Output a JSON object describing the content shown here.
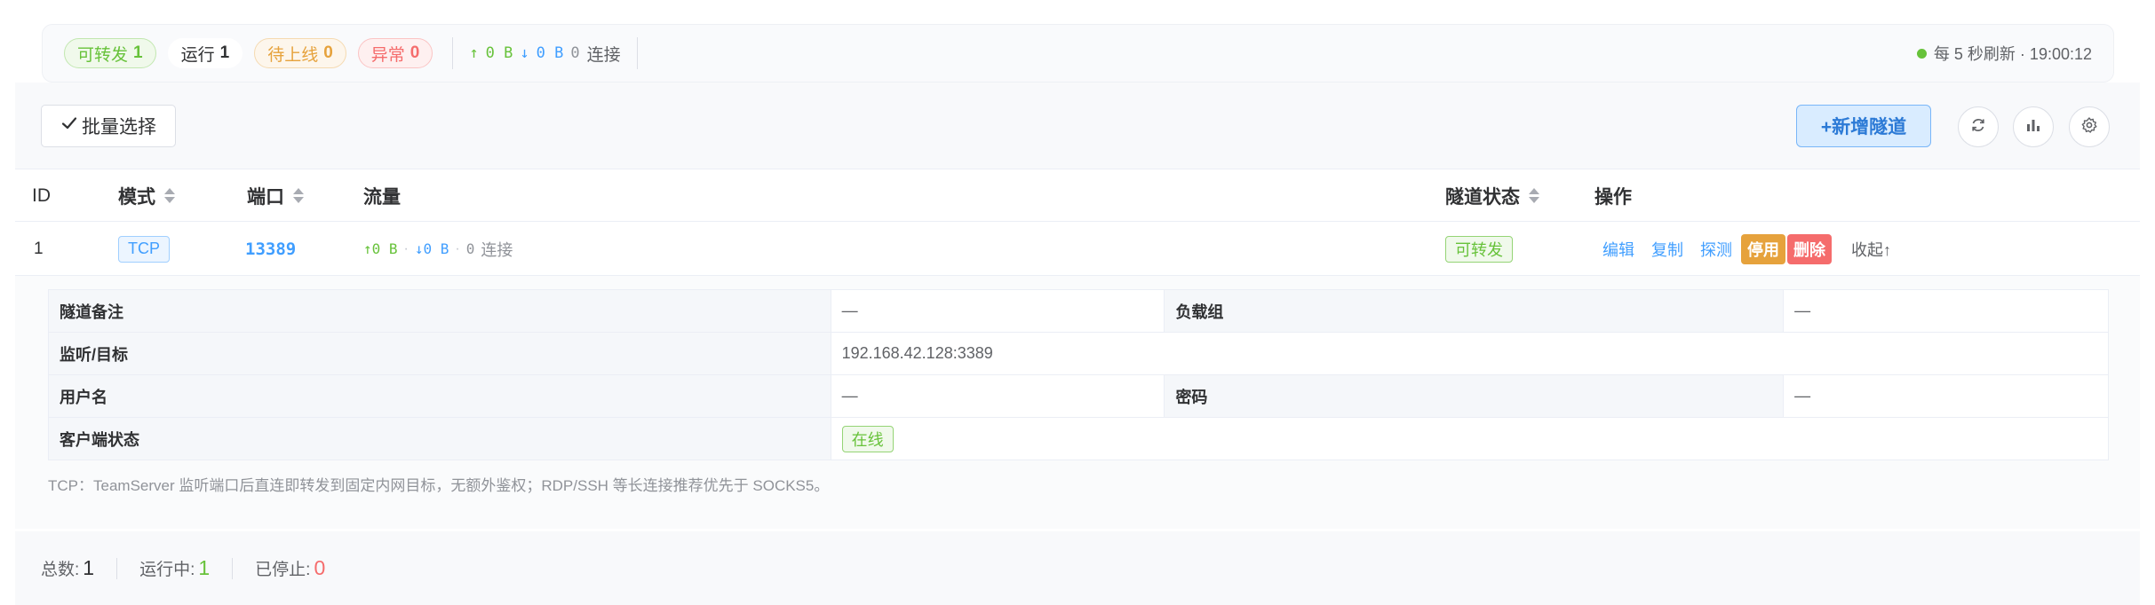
{
  "status": {
    "forwardable": {
      "label": "可转发",
      "count": "1"
    },
    "running": {
      "label": "运行",
      "count": "1"
    },
    "pending": {
      "label": "待上线",
      "count": "0"
    },
    "error": {
      "label": "异常",
      "count": "0"
    },
    "traffic": {
      "up_arrow": "↑",
      "up": "0 B",
      "down_arrow": "↓",
      "down": "0 B",
      "conn_count": "0",
      "conn_label": "连接"
    },
    "refresh_text": "每 5 秒刷新 · 19:00:12",
    "refresh_dot_color": "#67c23a"
  },
  "toolbar": {
    "batch_select": "批量选择",
    "batch_icon": "check-icon",
    "add_tunnel": "+新增隧道",
    "icons": [
      "refresh-icon",
      "bar-chart-icon",
      "settings-icon"
    ]
  },
  "table": {
    "headers": {
      "id": "ID",
      "mode": "模式",
      "port": "端口",
      "traffic": "流量",
      "status": "隧道状态",
      "ops": "操作"
    },
    "rows": [
      {
        "id": "1",
        "mode": "TCP",
        "port": "13389",
        "traffic": {
          "up": "↑0 B",
          "sep1": "·",
          "down": "↓0 B",
          "sep2": "·",
          "conn": "0",
          "conn_label": "连接"
        },
        "status": "可转发",
        "ops": {
          "edit": "编辑",
          "copy": "复制",
          "probe": "探测",
          "disable": "停用",
          "delete": "删除",
          "collapse": "收起↑"
        }
      }
    ]
  },
  "details": {
    "remark_label": "隧道备注",
    "remark_value": "—",
    "lb_group_label": "负载组",
    "lb_group_value": "—",
    "listen_label": "监听/目标",
    "listen_value": "192.168.42.128:3389",
    "username_label": "用户名",
    "username_value": "—",
    "password_label": "密码",
    "password_value": "—",
    "client_status_label": "客户端状态",
    "client_status_value": "在线",
    "note": "TCP：TeamServer 监听端口后直连即转发到固定内网目标，无额外鉴权；RDP/SSH 等长连接推荐优先于 SOCKS5。"
  },
  "footer": {
    "total_label": "总数:",
    "total": "1",
    "running_label": "运行中:",
    "running": "1",
    "stopped_label": "已停止:",
    "stopped": "0"
  },
  "colors": {
    "success": "#67c23a",
    "primary": "#409eff",
    "warning": "#e6a23c",
    "danger": "#f56c6c"
  }
}
